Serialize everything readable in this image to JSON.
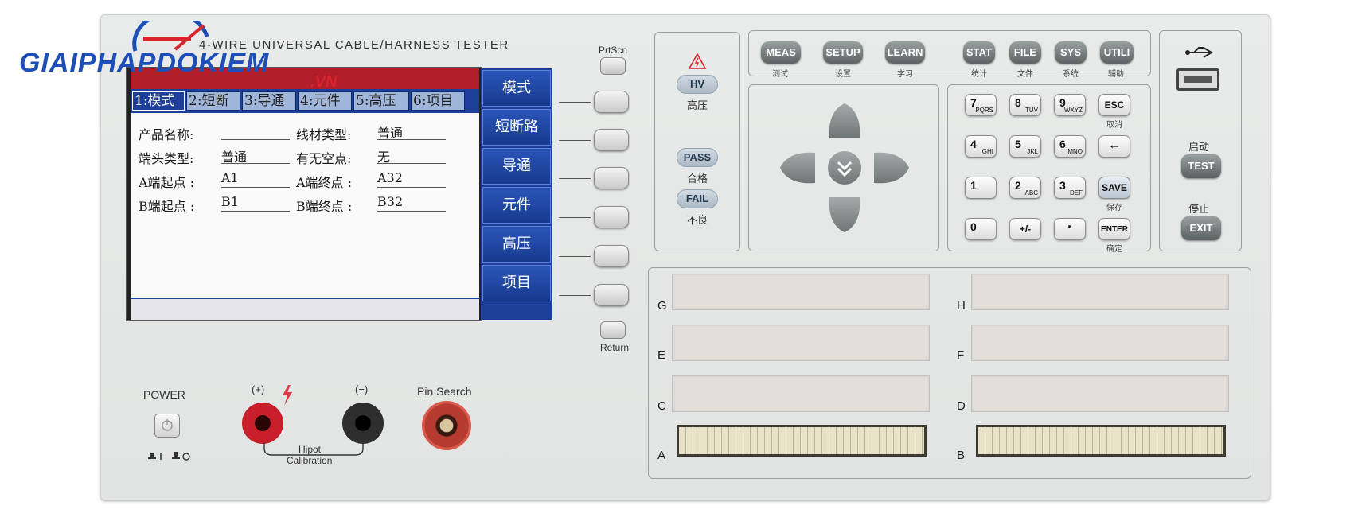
{
  "watermark": {
    "brand": "GIAIPHAPDOKIEM",
    "domain": ".VN",
    "brand_color": "#1e4fb8",
    "accent_color": "#d9232d"
  },
  "device": {
    "title": "4-WIRE UNIVERSAL CABLE/HARNESS TESTER"
  },
  "screen": {
    "tabs": [
      "1:模式",
      "2:短断",
      "3:导通",
      "4:元件",
      "5:高压",
      "6:项目"
    ],
    "active_tab": 0,
    "fields": {
      "product_name_label": "产品名称:",
      "product_name_value": "",
      "wire_type_label": "线材类型:",
      "wire_type_value": "普通",
      "terminal_type_label": "端头类型:",
      "terminal_type_value": "普通",
      "empty_point_label": "有无空点:",
      "empty_point_value": "无",
      "a_start_label": "A端起点 :",
      "a_start_value": "A1",
      "a_end_label": "A端终点 :",
      "a_end_value": "A32",
      "b_start_label": "B端起点 :",
      "b_start_value": "B1",
      "b_end_label": "B端终点 :",
      "b_end_value": "B32"
    },
    "softkeys": [
      "模式",
      "短断路",
      "导通",
      "元件",
      "高压",
      "项目"
    ],
    "header_color": "#b21d2a",
    "softkey_color": "#1d3f9a"
  },
  "side_buttons": {
    "top": "PrtScn",
    "bottom": "Return"
  },
  "indicators": {
    "hv": "HV",
    "hv_cn": "高压",
    "pass": "PASS",
    "pass_cn": "合格",
    "fail": "FAIL",
    "fail_cn": "不良"
  },
  "function_keys": [
    {
      "label": "MEAS",
      "cn": "测试"
    },
    {
      "label": "SETUP",
      "cn": "设置"
    },
    {
      "label": "LEARN",
      "cn": "学习"
    },
    {
      "label": "STAT",
      "cn": "统计"
    },
    {
      "label": "FILE",
      "cn": "文件"
    },
    {
      "label": "SYS",
      "cn": "系统"
    },
    {
      "label": "UTILI",
      "cn": "辅助"
    }
  ],
  "keypad": {
    "k7": "7",
    "k7s": "PQRS",
    "k8": "8",
    "k8s": "TUV",
    "k9": "9",
    "k9s": "WXYZ",
    "esc": "ESC",
    "esc_cn": "取消",
    "k4": "4",
    "k4s": "GHI",
    "k5": "5",
    "k5s": "JKL",
    "k6": "6",
    "k6s": "MNO",
    "back": "←",
    "k1": "1",
    "k2": "2",
    "k2s": "ABC",
    "k3": "3",
    "k3s": "DEF",
    "save": "SAVE",
    "save_cn": "保存",
    "k0": "0",
    "plusminus": "+/-",
    "dot": "·",
    "enter": "ENTER",
    "enter_cn": "确定"
  },
  "right_panel": {
    "usb_icon": "usb-icon",
    "start_cn": "启动",
    "test": "TEST",
    "stop_cn": "停止",
    "exit": "EXIT"
  },
  "front": {
    "power": "POWER",
    "plus": "(+)",
    "minus": "(−)",
    "pin_search": "Pin Search",
    "hipot": "Hipot",
    "calibration": "Calibration"
  },
  "slots": {
    "g": "G",
    "h": "H",
    "e": "E",
    "f": "F",
    "c": "C",
    "d": "D",
    "a": "A",
    "b": "B"
  }
}
